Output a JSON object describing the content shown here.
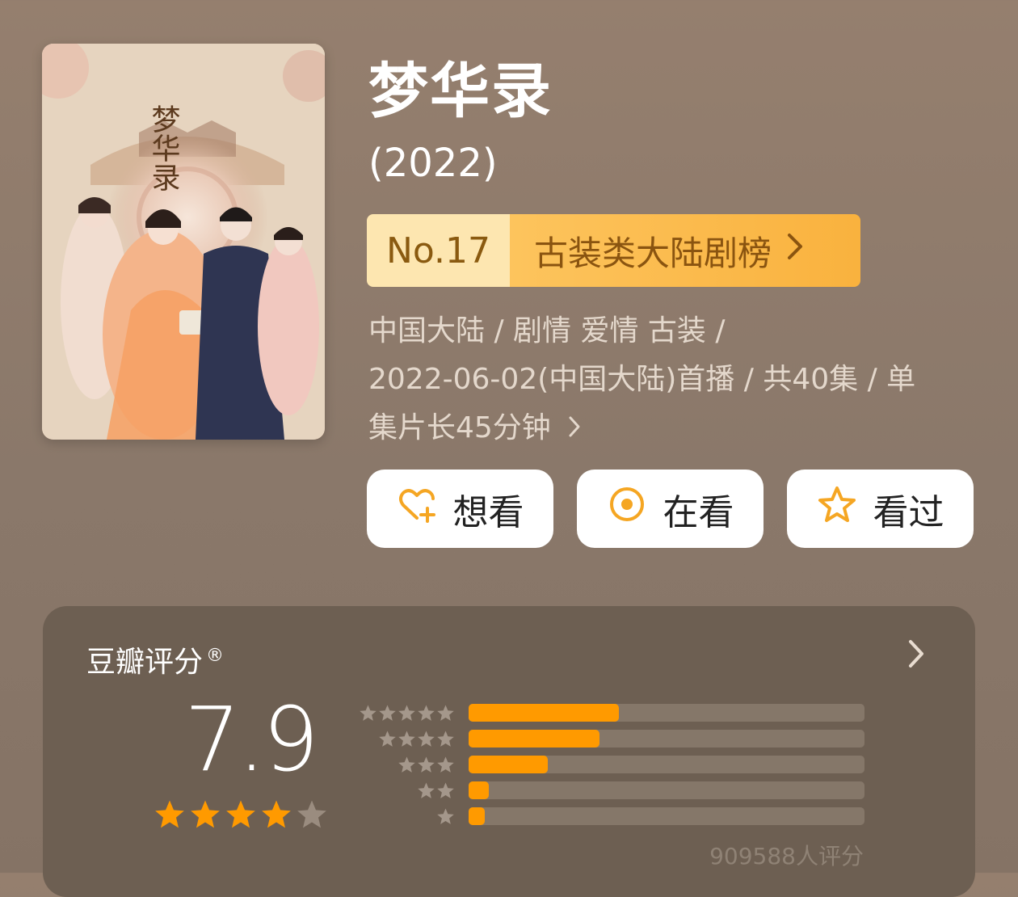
{
  "poster": {
    "calligraphy": "梦华录"
  },
  "title": "梦华录",
  "year": "(2022)",
  "ranking": {
    "number": "No.17",
    "list_name": "古装类大陆剧榜"
  },
  "meta": {
    "line1": "中国大陆 / 剧情 爱情 古装 /",
    "line2": "2022-06-02(中国大陆)首播 / 共40集 / 单",
    "line3": "集片长45分钟",
    "chevron": "›"
  },
  "actions": {
    "want": {
      "label": "想看",
      "icon": "heart-plus-icon"
    },
    "watching": {
      "label": "在看",
      "icon": "target-circle-icon"
    },
    "watched": {
      "label": "看过",
      "icon": "star-outline-icon"
    }
  },
  "rating": {
    "title": "豆瓣评分",
    "registered": "®",
    "score": "7.9",
    "stars_filled": 4,
    "stars_total": 5,
    "distribution": [
      {
        "stars": 5,
        "fraction": 0.38
      },
      {
        "stars": 4,
        "fraction": 0.33
      },
      {
        "stars": 3,
        "fraction": 0.2
      },
      {
        "stars": 2,
        "fraction": 0.05
      },
      {
        "stars": 1,
        "fraction": 0.035
      }
    ],
    "count_text": "909588人评分"
  },
  "colors": {
    "accent": "#ff9a00",
    "icon_orange": "#f5a623",
    "rank_light": "#fde6b0",
    "rank_strong": "#f9b23e",
    "card_bg": "#6d5f52"
  }
}
